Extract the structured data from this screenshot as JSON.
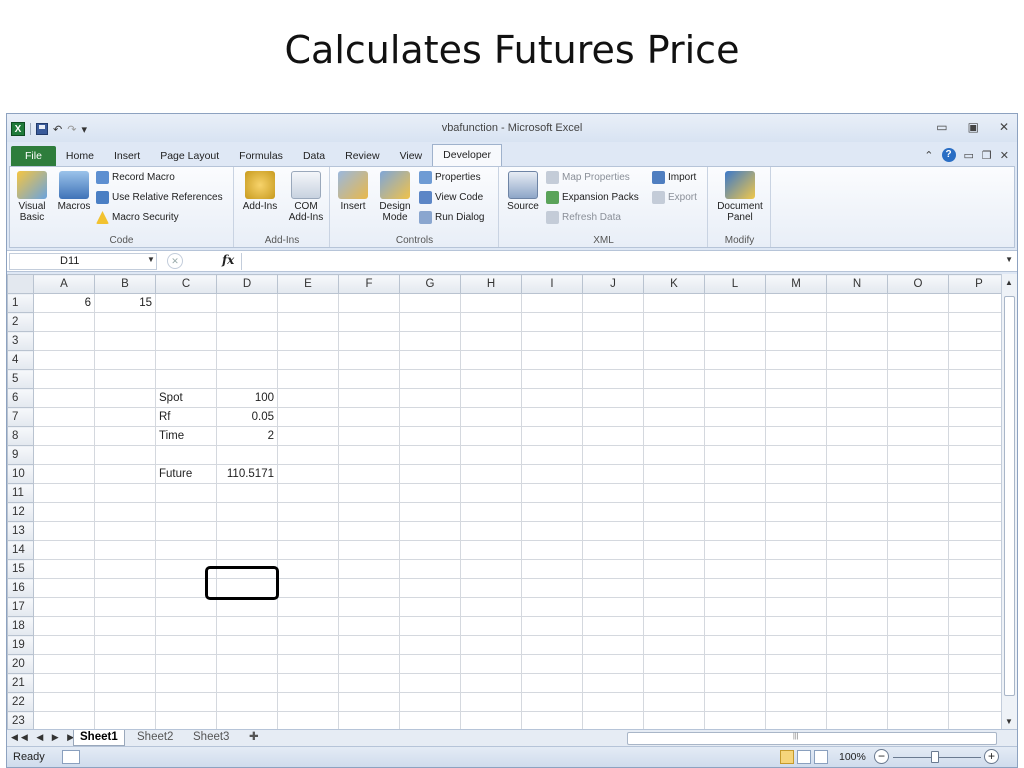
{
  "slide": {
    "title": "Calculates Futures Price"
  },
  "window": {
    "title": "vbafunction - Microsoft Excel",
    "qat_undo": "↶",
    "qat_redo": "↷"
  },
  "tabs": [
    {
      "label": "File"
    },
    {
      "label": "Home"
    },
    {
      "label": "Insert"
    },
    {
      "label": "Page Layout"
    },
    {
      "label": "Formulas"
    },
    {
      "label": "Data"
    },
    {
      "label": "Review"
    },
    {
      "label": "View"
    },
    {
      "label": "Developer"
    }
  ],
  "active_tab": "Developer",
  "ribbon": {
    "code": {
      "label": "Code",
      "visual_basic": "Visual\nBasic",
      "macros": "Macros",
      "record_macro": "Record Macro",
      "relative_refs": "Use Relative References",
      "macro_security": "Macro Security"
    },
    "addins": {
      "label": "Add-Ins",
      "addins": "Add-Ins",
      "com_addins": "COM\nAdd-Ins"
    },
    "controls": {
      "label": "Controls",
      "insert": "Insert",
      "design_mode": "Design\nMode",
      "properties": "Properties",
      "view_code": "View Code",
      "run_dialog": "Run Dialog"
    },
    "xml": {
      "label": "XML",
      "source": "Source",
      "map_properties": "Map Properties",
      "expansion_packs": "Expansion Packs",
      "refresh_data": "Refresh Data",
      "import": "Import",
      "export": "Export"
    },
    "modify": {
      "label": "Modify",
      "document_panel": "Document\nPanel"
    }
  },
  "formula_bar": {
    "name_box": "D11",
    "fx": "fx",
    "formula": ""
  },
  "grid": {
    "columns": [
      "A",
      "B",
      "C",
      "D",
      "E",
      "F",
      "G",
      "H",
      "I",
      "J",
      "K",
      "L",
      "M",
      "N",
      "O",
      "P"
    ],
    "row_count": 23,
    "cells": {
      "1": {
        "A": "6",
        "B": "15"
      },
      "6": {
        "C": "Spot",
        "D": "100"
      },
      "7": {
        "C": "Rf",
        "D": "0.05"
      },
      "8": {
        "C": "Time",
        "D": "2"
      },
      "10": {
        "C": "Future",
        "D": "110.5171"
      }
    }
  },
  "sheets": [
    "Sheet1",
    "Sheet2",
    "Sheet3"
  ],
  "active_sheet": "Sheet1",
  "status": {
    "ready": "Ready",
    "zoom": "100%"
  }
}
